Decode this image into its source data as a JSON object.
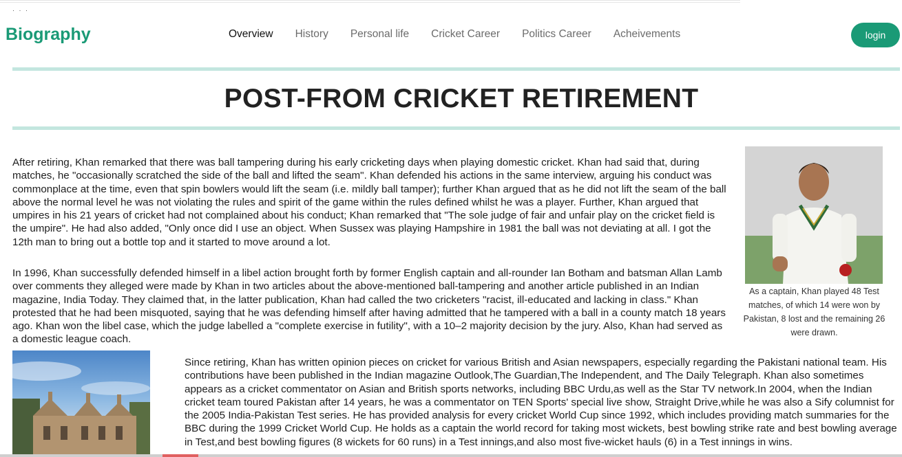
{
  "header": {
    "brand": "Biography",
    "nav": [
      {
        "label": "Overview",
        "active": true
      },
      {
        "label": "History",
        "active": false
      },
      {
        "label": "Personal life",
        "active": false
      },
      {
        "label": "Cricket Career",
        "active": false
      },
      {
        "label": "Politics Career",
        "active": false
      },
      {
        "label": "Acheivements",
        "active": false
      }
    ],
    "login_label": "login"
  },
  "colors": {
    "accent": "#1a9a76",
    "rule": "#c3e6df"
  },
  "main": {
    "title": "POST-FROM CRICKET RETIREMENT",
    "paragraphs": [
      "After retiring, Khan remarked that there was ball tampering during his early cricketing days when playing domestic cricket. Khan had said that, during matches, he \"occasionally scratched the side of the ball and lifted the seam\". Khan defended his actions in the same interview, arguing his conduct was commonplace at the time, even that spin bowlers would lift the seam (i.e. mildly ball tamper); further Khan argued that as he did not lift the seam of the ball above the normal level he was not violating the rules and spirit of the game within the rules defined whilst he was a player. Further, Khan argued that umpires in his 21 years of cricket had not complained about his conduct; Khan remarked that \"The sole judge of fair and unfair play on the cricket field is the umpire\". He had also added, \"Only once did I use an object. When Sussex was playing Hampshire in 1981 the ball was not deviating at all. I got the 12th man to bring out a bottle top and it started to move around a lot.",
      "In 1996, Khan successfully defended himself in a libel action brought forth by former English captain and all-rounder Ian Botham and batsman Allan Lamb over comments they alleged were made by Khan in two articles about the above-mentioned ball-tampering and another article published in an Indian magazine, India Today. They claimed that, in the latter publication, Khan had called the two cricketers \"racist, ill-educated and lacking in class.\" Khan protested that he had been misquoted, saying that he was defending himself after having admitted that he tampered with a ball in a county match 18 years ago. Khan won the libel case, which the judge labelled a \"complete exercise in futility\", with a 10–2 majority decision by the jury. Also, Khan had served as a domestic league coach.",
      "Since retiring, Khan has written opinion pieces on cricket for various British and Asian newspapers, especially regarding the Pakistani national team. His contributions have been published in the Indian magazine Outlook,The Guardian,The Independent, and The Daily Telegraph. Khan also sometimes appears as a cricket commentator on Asian and British sports networks, including BBC Urdu,as well as the Star TV network.In 2004, when the Indian cricket team toured Pakistan after 14 years, he was a commentator on TEN Sports' special live show, Straight Drive,while he was also a Sify columnist for the 2005 India-Pakistan Test series. He has provided analysis for every cricket World Cup since 1992, which includes providing match summaries for the BBC during the 1999 Cricket World Cup. He holds as a captain the world record for taking most wickets, best bowling strike rate and best bowling average in Test,and best bowling figures (8 wickets for 60 runs) in a Test innings,and also most five-wicket hauls (6) in a Test innings in wins."
    ],
    "portrait_caption": "As a captain, Khan played 48 Test matches, of which 14 were won by Pakistan, 8 lost and the remaining 26 were drawn."
  }
}
